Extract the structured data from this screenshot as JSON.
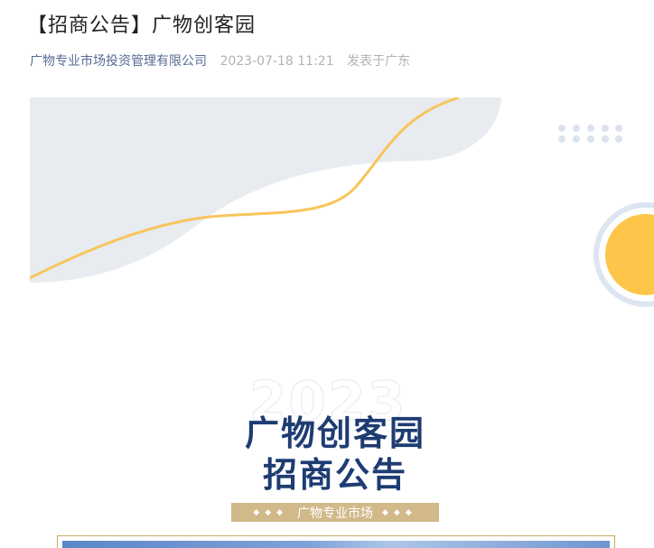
{
  "article": {
    "title": "【招商公告】广物创客园",
    "author": "广物专业市场投资管理有限公司",
    "datetime": "2023-07-18 11:21",
    "location": "发表于广东"
  },
  "poster": {
    "watermark": "2023",
    "headline_line1": "广物创客园",
    "headline_line2": "招商公告",
    "ribbon_dots": "◆◆◆",
    "ribbon_text": "广物专业市场"
  },
  "colors": {
    "headline": "#1e3c72",
    "accent_yellow": "#f8c55a",
    "ribbon": "#d2b98a",
    "author_link": "#576b95"
  }
}
